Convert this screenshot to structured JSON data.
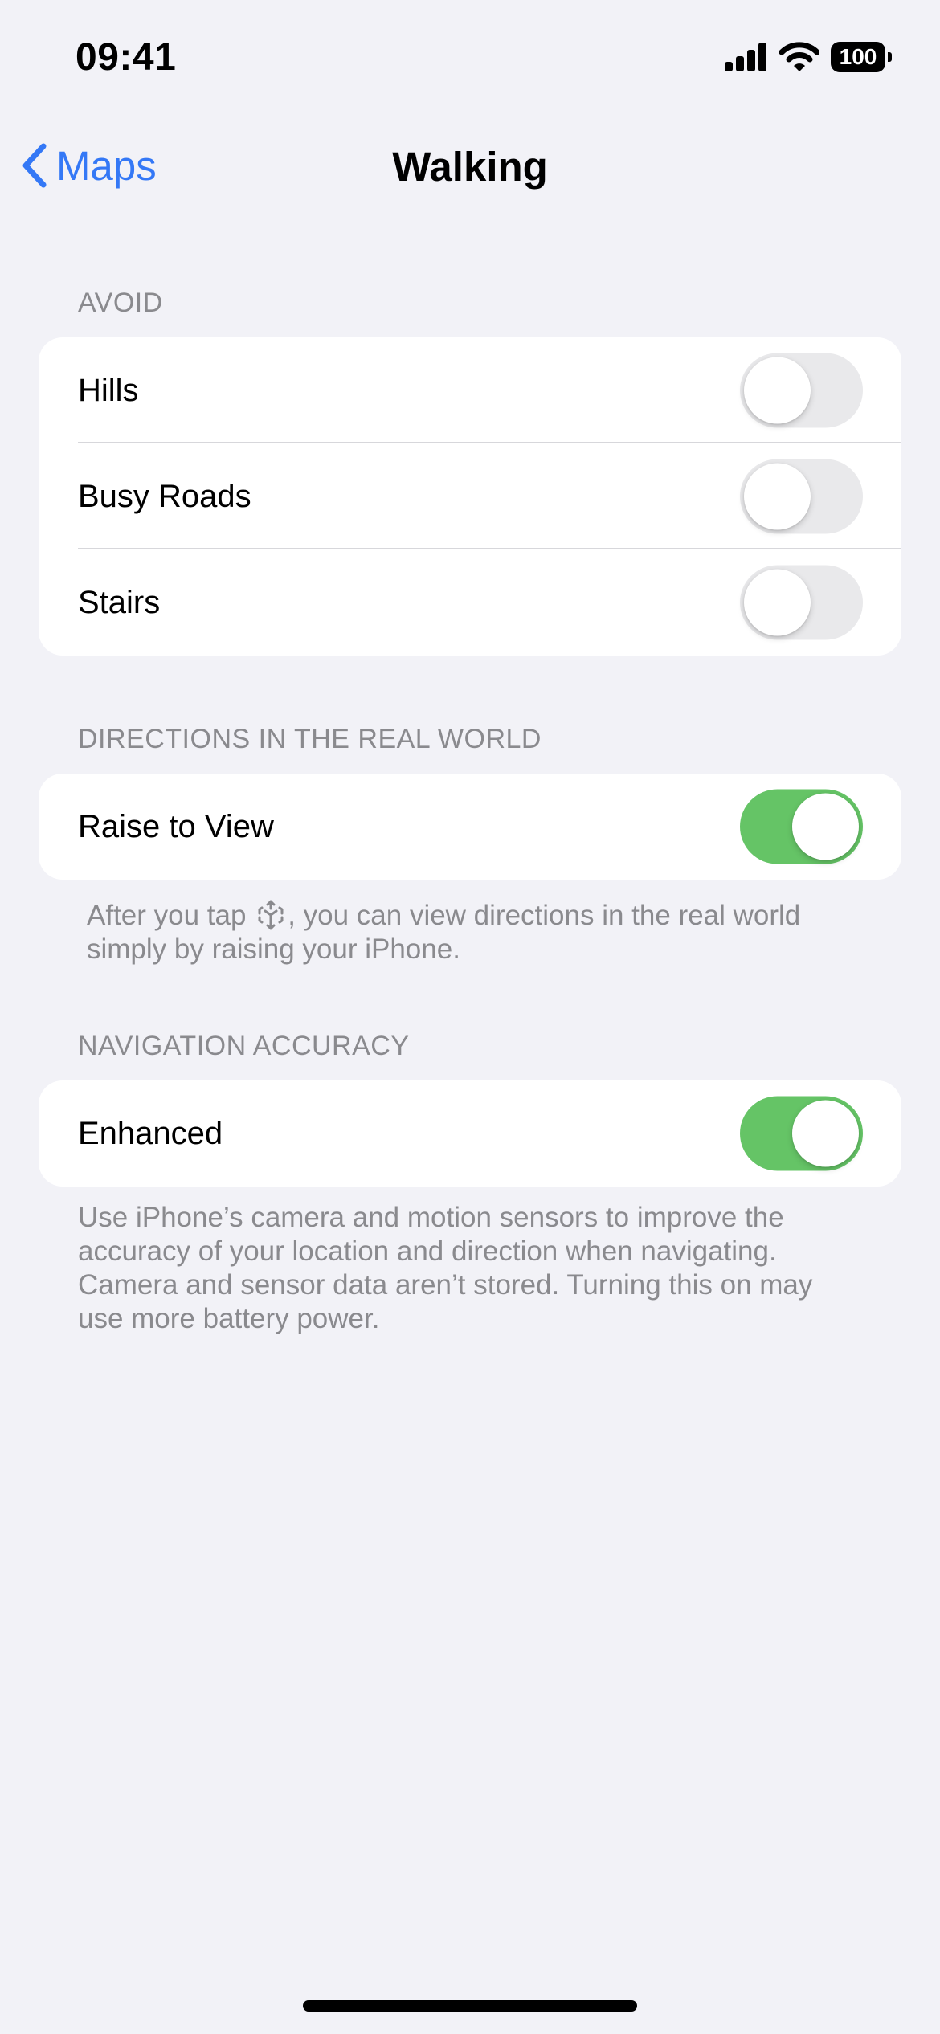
{
  "status_bar": {
    "time": "09:41",
    "battery_level": "100",
    "icons": [
      "cellular-signal-icon",
      "wifi-icon",
      "battery-icon"
    ]
  },
  "nav": {
    "back_label": "Maps",
    "back_icon": "chevron-left-icon",
    "title": "Walking"
  },
  "sections": {
    "avoid": {
      "header": "AVOID",
      "rows": [
        {
          "label": "Hills",
          "on": false
        },
        {
          "label": "Busy Roads",
          "on": false
        },
        {
          "label": "Stairs",
          "on": false
        }
      ]
    },
    "directions": {
      "header": "DIRECTIONS IN THE REAL WORLD",
      "rows": [
        {
          "label": "Raise to View",
          "on": true
        }
      ],
      "footer_before_icon": "After you tap",
      "footer_icon": "ar-view-icon",
      "footer_after_icon": ", you can view directions in the real world simply by raising your iPhone."
    },
    "accuracy": {
      "header": "NAVIGATION ACCURACY",
      "rows": [
        {
          "label": "Enhanced",
          "on": true
        }
      ],
      "footer": "Use iPhone’s camera and motion sensors to improve the accuracy of your location and direction when navigating. Camera and sensor data aren’t stored. Turning this on may use more battery power."
    }
  },
  "colors": {
    "accent": "#3478f6",
    "toggle_on": "#65c466",
    "toggle_off": "#e9e9eb",
    "background": "#f2f2f7",
    "secondary_text": "#8a8a8e"
  }
}
